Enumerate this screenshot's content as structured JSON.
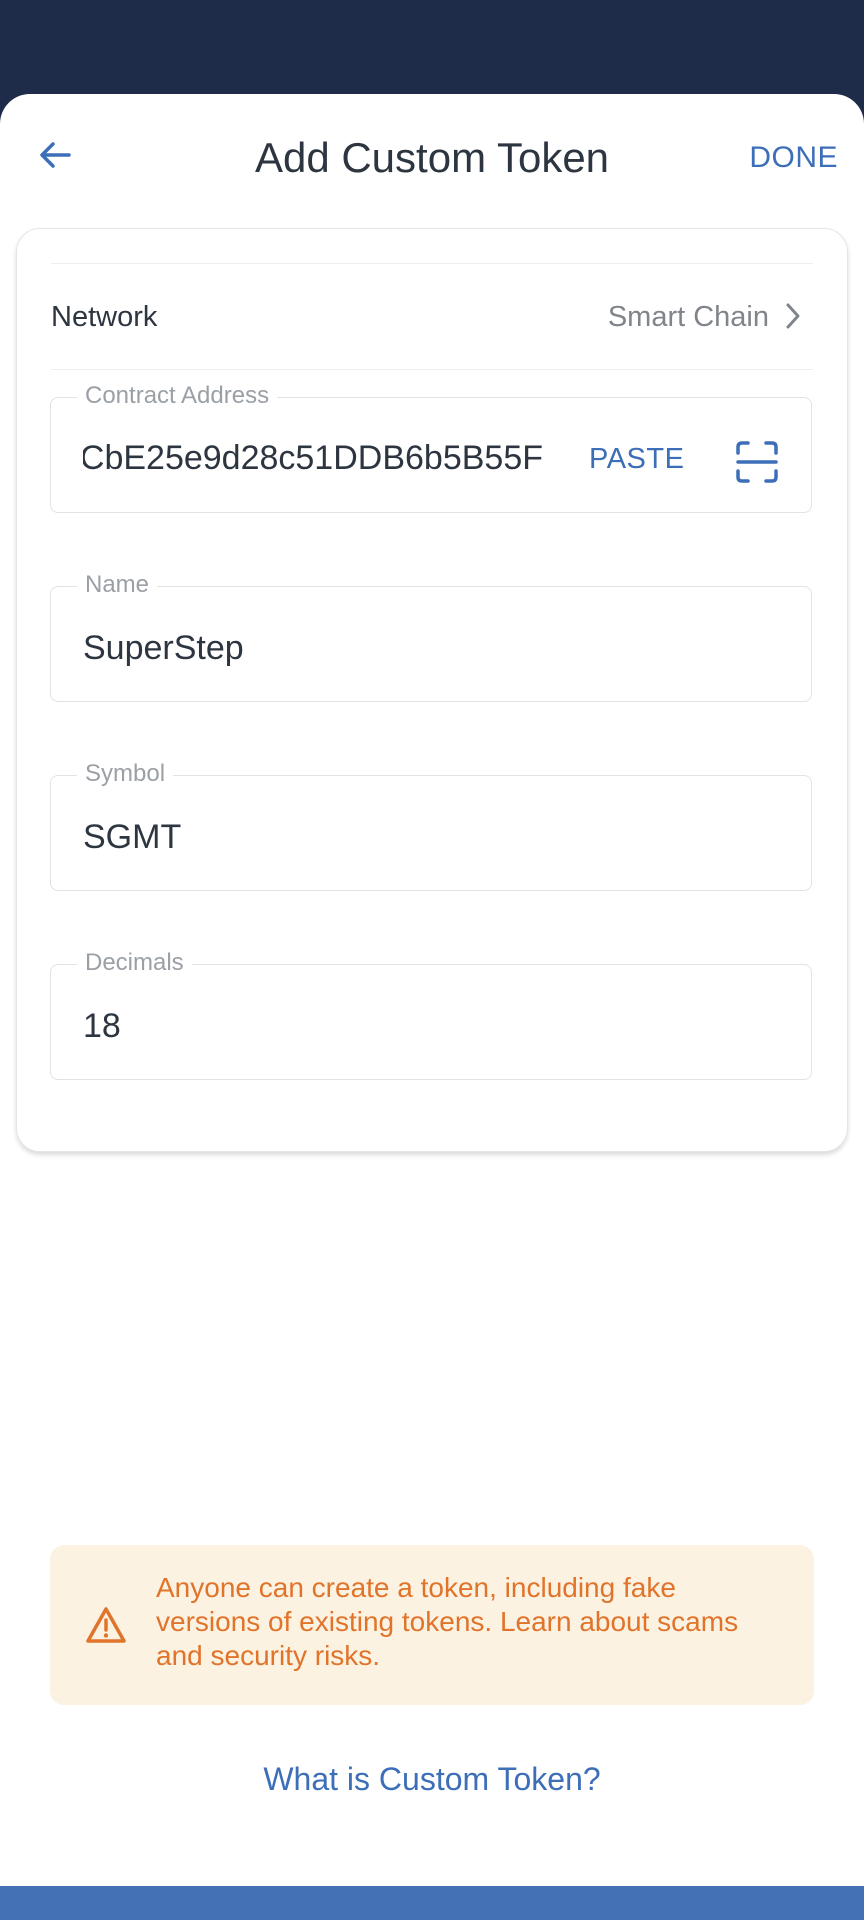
{
  "header": {
    "title": "Add Custom Token",
    "done_label": "DONE"
  },
  "network": {
    "label": "Network",
    "value": "Smart Chain"
  },
  "fields": {
    "contract_address": {
      "label": "Contract Address",
      "value": "CbE25e9d28c51DDB6b5B55F",
      "paste_label": "PASTE"
    },
    "name": {
      "label": "Name",
      "value": "SuperStep"
    },
    "symbol": {
      "label": "Symbol",
      "value": "SGMT"
    },
    "decimals": {
      "label": "Decimals",
      "value": "18"
    }
  },
  "warning": {
    "text": "Anyone can create a token, including fake versions of existing tokens. Learn about scams and security risks."
  },
  "help_link": "What is Custom Token?",
  "icons": {
    "back": "arrow-left-icon",
    "network_chevron": "chevron-right-icon",
    "scan": "scan-qr-icon",
    "warning": "warning-triangle-icon"
  },
  "colors": {
    "accent": "#3d6eb8",
    "warning_text": "#e0742a",
    "warning_bg": "#fcf2e2",
    "status_bar": "#1f2c49"
  }
}
